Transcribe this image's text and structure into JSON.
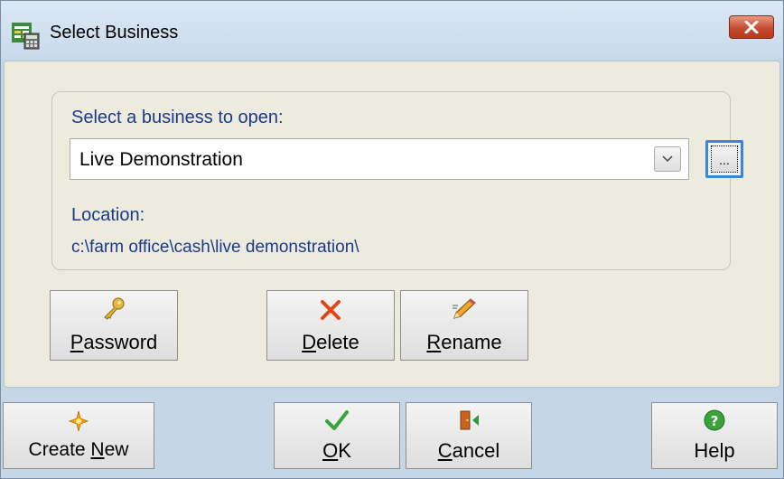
{
  "window": {
    "title": "Select Business",
    "icon": "calculator-spreadsheet-icon"
  },
  "group": {
    "prompt_label": "Select a business to open:",
    "business_select": {
      "value": "Live Demonstration"
    },
    "browse_label": "...",
    "location_label": "Location:",
    "location_path": "c:\\farm office\\cash\\live demonstration\\"
  },
  "business_actions": {
    "password": {
      "label_pre": "",
      "mnemonic": "P",
      "label_post": "assword",
      "icon": "key-icon"
    },
    "delete": {
      "label_pre": "",
      "mnemonic": "D",
      "label_post": "elete",
      "icon": "red-x-icon"
    },
    "rename": {
      "label_pre": "",
      "mnemonic": "R",
      "label_post": "ename",
      "icon": "pencil-icon"
    }
  },
  "footer": {
    "create_new": {
      "label_pre": "Create ",
      "mnemonic": "N",
      "label_post": "ew",
      "icon": "sparkle-icon"
    },
    "ok": {
      "label_pre": "",
      "mnemonic": "O",
      "label_post": "K",
      "icon": "check-icon"
    },
    "cancel": {
      "label_pre": "",
      "mnemonic": "C",
      "label_post": "ancel",
      "icon": "exit-door-icon"
    },
    "help": {
      "label_pre": "Help",
      "mnemonic": "",
      "label_post": "",
      "icon": "help-icon"
    }
  },
  "colors": {
    "label_text": "#1a3a8f",
    "dialog_body": "#edebdd",
    "frame": "#c5d6e8",
    "close_button": "#c44d31",
    "focus_ring": "#3c86d6"
  }
}
